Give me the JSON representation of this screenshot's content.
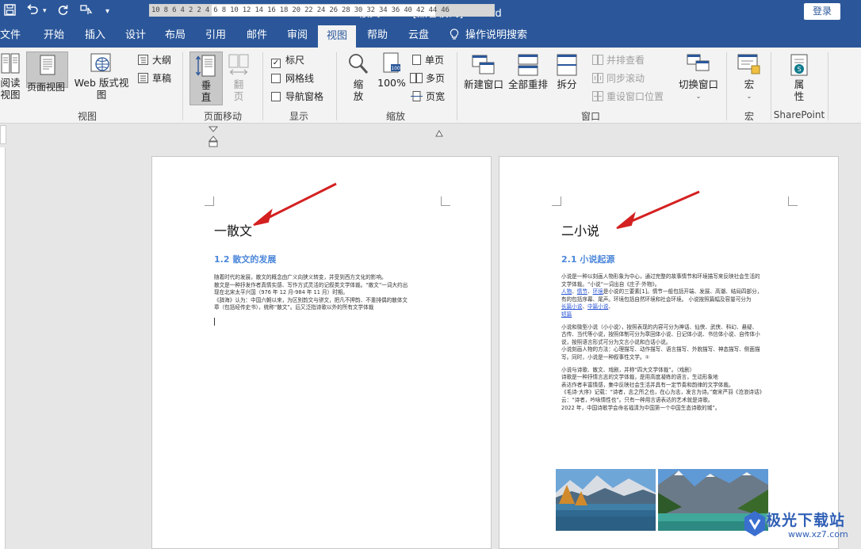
{
  "titlebar": {
    "doc_title": "散文.docx [兼容模式]  -  Word",
    "login_label": "登录",
    "accent": "#2b579a"
  },
  "tabs": [
    "文件",
    "开始",
    "插入",
    "设计",
    "布局",
    "引用",
    "邮件",
    "审阅",
    "视图",
    "帮助",
    "云盘"
  ],
  "active_tab": "视图",
  "tell_me": "操作说明搜索",
  "ribbon": {
    "views": {
      "read_mode": "阅读\n视图",
      "print_layout": "页面视图",
      "web_layout": "Web 版式视图",
      "outline": "大纲",
      "draft": "草稿",
      "group_label": "视图"
    },
    "page_move": {
      "vertical": "垂\n直",
      "side_to_side": "翻\n页",
      "group_label": "页面移动"
    },
    "show": {
      "ruler": "标尺",
      "ruler_checked": true,
      "gridlines": "网格线",
      "gridlines_checked": false,
      "nav_pane": "导航窗格",
      "nav_pane_checked": false,
      "group_label": "显示"
    },
    "zoom": {
      "zoom": "缩\n放",
      "hundred": "100%",
      "one_page": "单页",
      "multi_page": "多页",
      "page_width": "页宽",
      "group_label": "缩放"
    },
    "window": {
      "new_window": "新建窗口",
      "arrange_all": "全部重排",
      "split": "拆分",
      "side_by_side": "并排查看",
      "sync_scroll": "同步滚动",
      "reset_pos": "重设窗口位置",
      "switch_windows": "切换窗口",
      "group_label": "窗口"
    },
    "macros": {
      "macros": "宏",
      "group_label": "宏"
    },
    "sharepoint": {
      "properties": "属\n性",
      "group_label": "SharePoint"
    }
  },
  "ruler": {
    "numbers": "10  8  6  4  2     2  4  6  8  10 12 14 16 18 20 22 24 26 28 30 32 34 36    40 42 44 46"
  },
  "page1": {
    "heading": "一散文",
    "subheading": "1.2 散文的发展",
    "paragraphs": [
      "随着时代的发展，散文的概念由广义向狭义转变，并受到西方文化的影响。",
      "散文是一种抒发作者真情实感、写作方式灵活的记叙类文学体裁。“散文”一词大约出",
      "现在北宋太平兴国（976 年 12 月-984 年 11 月）时期。",
      "《辞海》认为：中国六朝以来，为区别韵文与骈文，把凡不押韵、不重排偶的散体文",
      "章（包括经传史书），统称“散文”。后又泛指诗歌以外的所有文学体裁"
    ]
  },
  "page2": {
    "heading": "二小说",
    "subheading": "2.1 小说起源",
    "para1": [
      "小说是一种以刻画人物形象为中心，通过完整的故事情节和环境描写来反映社会生活的",
      "文学体裁。“小说”一词出自《庄子·外物》。"
    ],
    "links_a": [
      "人物",
      "情节",
      "环境"
    ],
    "para2_rest": "是小说的三要素[1]。情节一般包括开端、发展、高潮、结局四部分，",
    "para2_line2": "有的包括序幕、尾声。环境包括自然环境和社会环境。 小说按照篇幅及容量可分为",
    "link_long": "长篇小说",
    "link_mid": "中篇小说",
    "link_short": "短篇",
    "para3": [
      "小说和微型小说（小小说），按照表现的内容可分为神话、仙侠、武侠、科幻、悬疑、",
      "古传、当代等小说，按照体制可分为章回体小说、日记体小说、书信体小说、自传体小",
      "说，按照语言形式可分为文言小说和白话小说。",
      "小说刻画人物的方法：心理描写、动作描写、语言描写、外貌描写、神态描写、侧面描",
      "写。同时，小说是一种叙事性文学。①"
    ],
    "para4": "小说与诗歌、散文、戏剧，并称“四大文学体裁”。（戏剧）",
    "para5": [
      "诗歌是一种抒情言志的文学体裁，是用高度凝练的语言，生动形象地",
      "表达作者丰富情感，集中反映社会生活并具有一定节奏和韵律的文学体裁。",
      "《毛诗·大序》记载：“诗者，志之所之也，在心为志，发言为诗。”南宋严羽《沧浪诗话》",
      "云：“诗者，吟咏情性也”。只有一种用言语表达的艺术就是诗歌。",
      "2022 年，中国诗歌学会命名福清为中国第一个中国生态诗歌的城”。"
    ]
  },
  "watermark": {
    "text": "极光下载站",
    "url": "www.xz7.com"
  }
}
